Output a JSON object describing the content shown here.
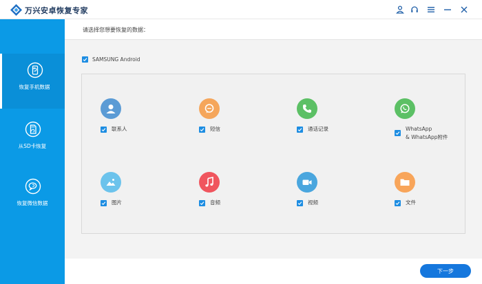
{
  "app": {
    "title": "万兴安卓恢复专家"
  },
  "titlebar": {
    "icons": [
      "user-icon",
      "headset-icon",
      "menu-icon",
      "minimize-icon",
      "close-icon"
    ]
  },
  "sidebar": {
    "items": [
      {
        "label": "恢复手机数据",
        "icon": "phone-recover-icon",
        "active": true
      },
      {
        "label": "从SD卡恢复",
        "icon": "sd-card-icon",
        "active": false
      },
      {
        "label": "恢复微信数据",
        "icon": "chat-bubble-icon",
        "active": false
      }
    ]
  },
  "main": {
    "prompt": "请选择您想要恢复的数据：",
    "device": {
      "label": "SAMSUNG Android",
      "checked": true
    },
    "data_types": [
      {
        "label": "联系人",
        "icon": "contact-icon",
        "color": "#5b9bd5",
        "checked": true
      },
      {
        "label": "短信",
        "icon": "message-icon",
        "color": "#f5a65b",
        "checked": true
      },
      {
        "label": "通话记录",
        "icon": "phone-icon",
        "color": "#5cc065",
        "checked": true
      },
      {
        "label": "WhatsApp",
        "label2": "& WhatsApp附件",
        "icon": "whatsapp-icon",
        "color": "#5cc065",
        "checked": true
      },
      {
        "label": "图片",
        "icon": "picture-icon",
        "color": "#6cc3ec",
        "checked": true
      },
      {
        "label": "音频",
        "icon": "music-icon",
        "color": "#f0555e",
        "checked": true
      },
      {
        "label": "视频",
        "icon": "video-icon",
        "color": "#4aa6de",
        "checked": true
      },
      {
        "label": "文件",
        "icon": "folder-icon",
        "color": "#f8a55a",
        "checked": true
      }
    ]
  },
  "footer": {
    "next_label": "下一步"
  },
  "colors": {
    "sidebar": "#0b9ae6",
    "accent": "#1577dd",
    "checkbox": "#1d8de2"
  }
}
